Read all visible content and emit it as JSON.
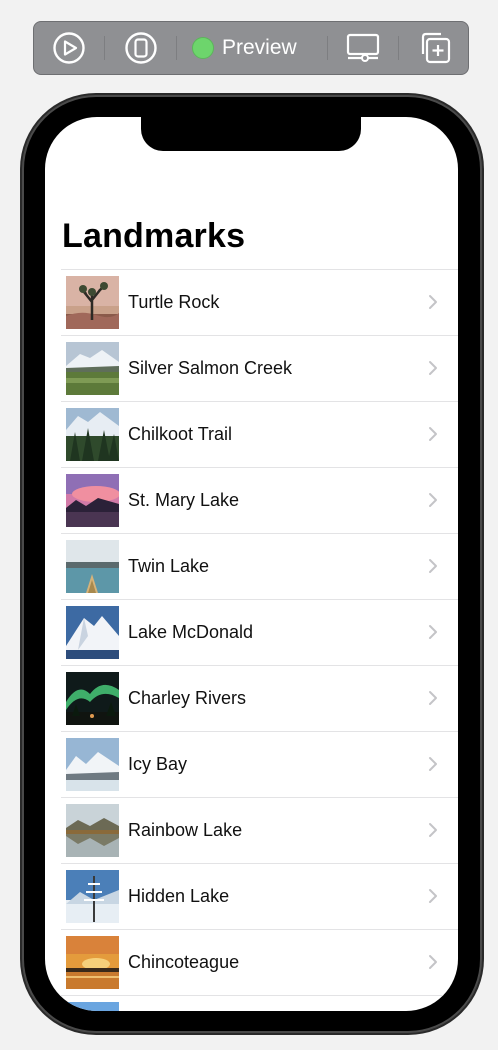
{
  "toolbar": {
    "play_icon": "play-circle-icon",
    "device_icon": "device-icon",
    "preview_label": "Preview",
    "preview_status_color": "#6dd56c",
    "display_settings_icon": "display-settings-icon",
    "duplicate_icon": "duplicate-add-icon"
  },
  "app": {
    "title": "Landmarks",
    "landmarks": [
      {
        "name": "Turtle Rock",
        "thumb": "desert-tree"
      },
      {
        "name": "Silver Salmon Creek",
        "thumb": "mountain-meadow"
      },
      {
        "name": "Chilkoot Trail",
        "thumb": "forest-mountains"
      },
      {
        "name": "St. Mary Lake",
        "thumb": "sunset-lake"
      },
      {
        "name": "Twin Lake",
        "thumb": "canoe-lake"
      },
      {
        "name": "Lake McDonald",
        "thumb": "snowy-peak"
      },
      {
        "name": "Charley Rivers",
        "thumb": "aurora"
      },
      {
        "name": "Icy Bay",
        "thumb": "icy-mountains"
      },
      {
        "name": "Rainbow Lake",
        "thumb": "reflection-lake"
      },
      {
        "name": "Hidden Lake",
        "thumb": "frozen-tree"
      },
      {
        "name": "Chincoteague",
        "thumb": "golden-sunset"
      },
      {
        "name": "",
        "thumb": "blue-sky"
      }
    ]
  },
  "colors": {
    "toolbar_bg": "#8f9093",
    "separator": "#e3e3e5",
    "chevron": "#c4c4c7"
  }
}
